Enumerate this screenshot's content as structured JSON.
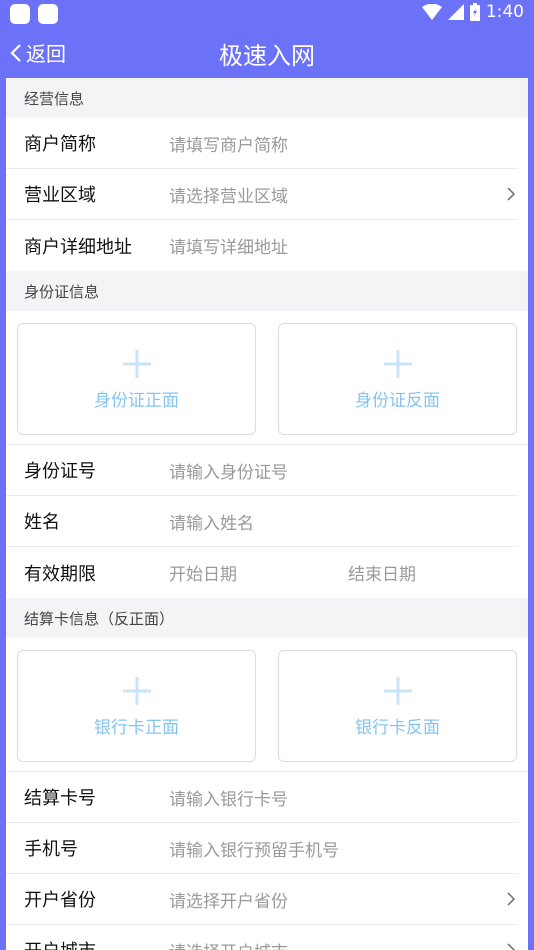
{
  "status_bar": {
    "time": "1:40"
  },
  "nav": {
    "back_label": "返回",
    "title": "极速入网"
  },
  "business_info": {
    "header": "经营信息",
    "rows": [
      {
        "label": "商户简称",
        "placeholder": "请填写商户简称"
      },
      {
        "label": "营业区域",
        "placeholder": "请选择营业区域"
      },
      {
        "label": "商户详细地址",
        "placeholder": "请填写详细地址"
      }
    ]
  },
  "id_info": {
    "header": "身份证信息",
    "upload_front": "身份证正面",
    "upload_back": "身份证反面",
    "rows": [
      {
        "label": "身份证号",
        "placeholder": "请输入身份证号"
      },
      {
        "label": "姓名",
        "placeholder": "请输入姓名"
      },
      {
        "label": "有效期限",
        "start_placeholder": "开始日期",
        "end_placeholder": "结束日期"
      }
    ]
  },
  "card_info": {
    "header": "结算卡信息（反正面）",
    "upload_front": "银行卡正面",
    "upload_back": "银行卡反面",
    "rows": [
      {
        "label": "结算卡号",
        "placeholder": "请输入银行卡号"
      },
      {
        "label": "手机号",
        "placeholder": "请输入银行预留手机号"
      },
      {
        "label": "开户省份",
        "placeholder": "请选择开户省份"
      },
      {
        "label": "开户城市",
        "placeholder": "请选择开户城市"
      }
    ]
  },
  "colors": {
    "accent": "#6c72f8",
    "upload_text": "#86c4f0",
    "placeholder": "#9a9a9a"
  }
}
